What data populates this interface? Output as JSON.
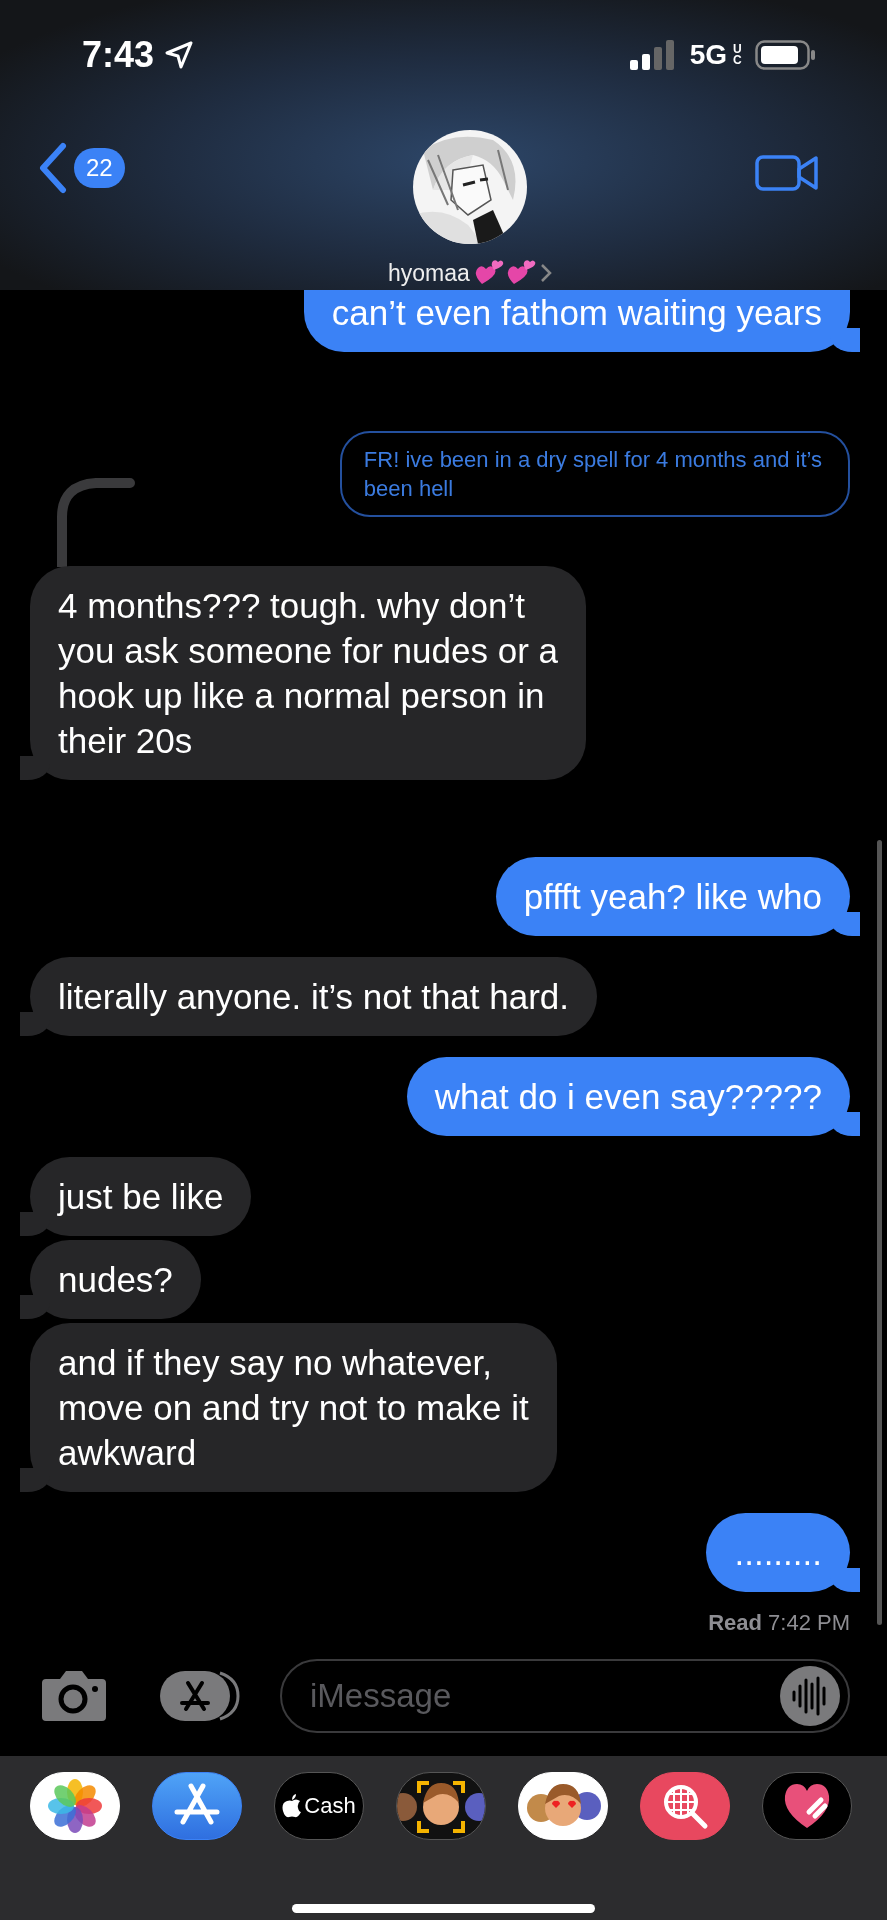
{
  "status_bar": {
    "time": "7:43",
    "network": "5G",
    "network_sub": "UC"
  },
  "header": {
    "back_badge": "22",
    "contact_name": "hyomaa"
  },
  "messages": [
    {
      "from_me": true,
      "kind": "normal",
      "text": "can’t even fathom waiting years"
    },
    {
      "from_me": true,
      "kind": "reply",
      "text": "FR! ive been in a dry spell for 4 months and it’s\nbeen hell"
    },
    {
      "from_me": false,
      "kind": "normal",
      "text": "4 months??? tough. why don’t\nyou ask someone for nudes or a\nhook up like a normal person in\ntheir 20s"
    },
    {
      "from_me": true,
      "kind": "normal",
      "text": "pffft yeah? like who"
    },
    {
      "from_me": false,
      "kind": "normal",
      "text": "literally anyone. it’s not that hard."
    },
    {
      "from_me": true,
      "kind": "normal",
      "text": "what do i even say?????"
    },
    {
      "from_me": false,
      "kind": "normal",
      "text": "just be like"
    },
    {
      "from_me": false,
      "kind": "normal",
      "text": "nudes?"
    },
    {
      "from_me": false,
      "kind": "normal",
      "text": "and if they say no whatever,\nmove on and try not to make it\nawkward"
    },
    {
      "from_me": true,
      "kind": "normal",
      "text": "........."
    }
  ],
  "read_receipt": {
    "label": "Read",
    "time": "7:42 PM"
  },
  "composer": {
    "placeholder": "iMessage"
  },
  "apps": [
    {
      "kind": "photos"
    },
    {
      "kind": "appstore"
    },
    {
      "kind": "cash",
      "label": "Cash"
    },
    {
      "kind": "memoji"
    },
    {
      "kind": "stickers"
    },
    {
      "kind": "search"
    },
    {
      "kind": "heart"
    }
  ]
}
